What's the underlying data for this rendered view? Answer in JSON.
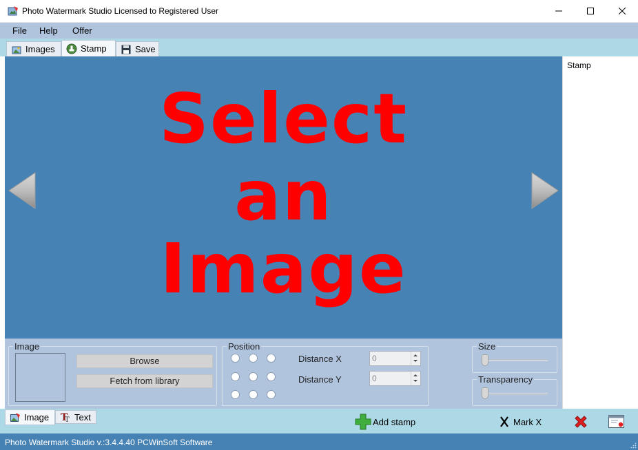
{
  "window": {
    "title": "Photo Watermark Studio Licensed to Registered User",
    "icon": "app-photo-icon",
    "controls": [
      "minimize",
      "maximize",
      "close"
    ]
  },
  "menu": [
    "File",
    "Help",
    "Offer"
  ],
  "tabs": [
    {
      "label": "Images",
      "icon": "images-icon",
      "active": false
    },
    {
      "label": "Stamp",
      "icon": "stamp-icon",
      "active": true
    },
    {
      "label": "Save",
      "icon": "floppy-disk-icon",
      "active": false
    }
  ],
  "canvas": {
    "placeholder_lines": [
      "Select",
      "an",
      "Image"
    ],
    "background": "#4682b4",
    "text_color": "#ff0000",
    "prev_icon": "arrow-left-icon",
    "next_icon": "arrow-right-icon"
  },
  "stamp_panel": {
    "label": "Stamp"
  },
  "image_group": {
    "title": "Image",
    "browse_label": "Browse",
    "fetch_label": "Fetch from library"
  },
  "position_group": {
    "title": "Position",
    "distance_x_label": "Distance X",
    "distance_y_label": "Distance Y",
    "distance_x_value": "0",
    "distance_y_value": "0"
  },
  "size_group": {
    "title": "Size",
    "value": 0
  },
  "transparency_group": {
    "title": "Transparency",
    "value": 0
  },
  "bottom_tabs": [
    {
      "label": "Image",
      "icon": "image-icon",
      "active": true
    },
    {
      "label": "Text",
      "icon": "text-icon",
      "active": false
    }
  ],
  "actions": {
    "add_stamp": "Add stamp",
    "mark_x": "Mark X",
    "delete_icon": "red-x-icon",
    "window_icon": "window-close-icon"
  },
  "status": {
    "text": "Photo Watermark Studio v.:3.4.4.40 PCWinSoft Software"
  },
  "colors": {
    "menubar": "#b0c4de",
    "tabstrip": "#add8e6",
    "statusbar": "#4682b4"
  }
}
